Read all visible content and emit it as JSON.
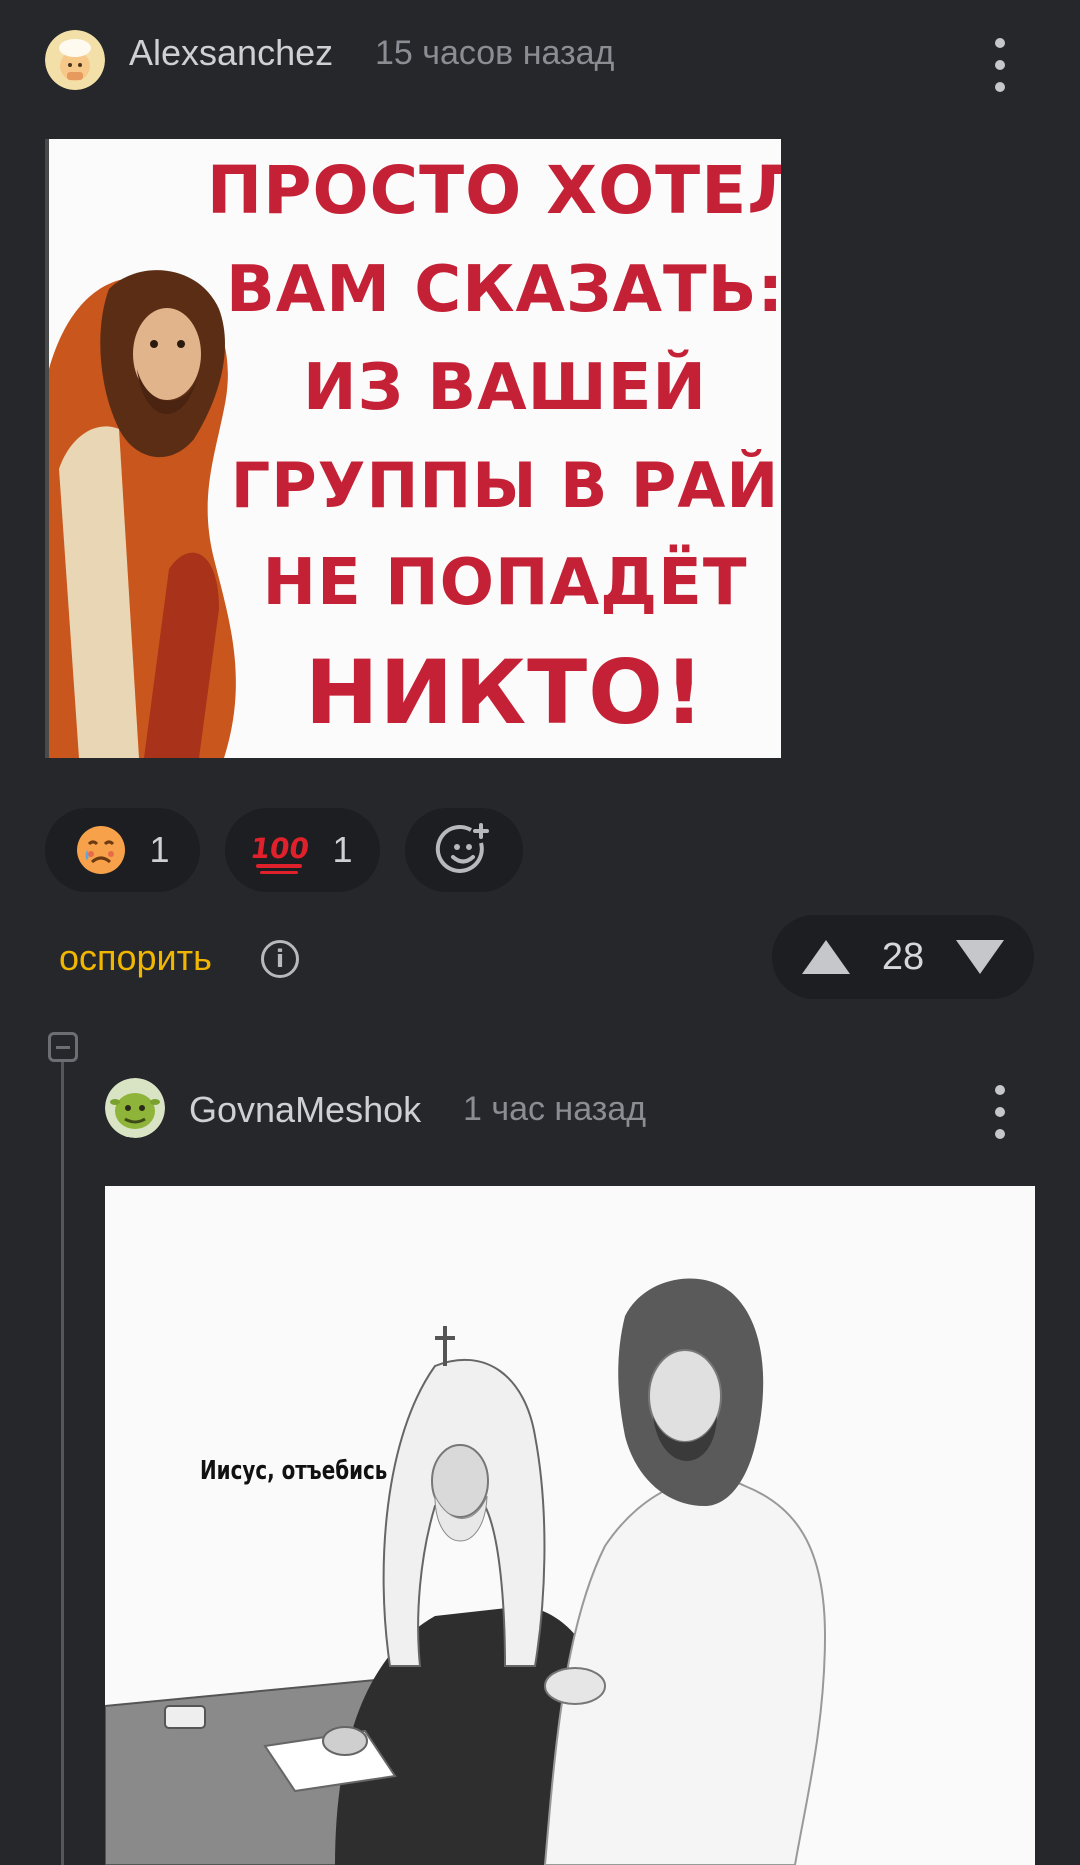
{
  "comments": [
    {
      "author": "Alexsanchez",
      "time": "15 часов назад",
      "avatar_icon": "avatar-baby-icon",
      "image_text_lines": [
        "ПРОСТО ХОТЕЛ",
        "ВАМ СКАЗАТЬ:",
        "ИЗ ВАШЕЙ",
        "ГРУППЫ В РАЙ",
        "НЕ ПОПАДЁТ",
        "НИКТО!"
      ],
      "reactions": [
        {
          "icon": "sad-tear-emoji-icon",
          "count": "1"
        },
        {
          "icon": "hundred-points-emoji-icon",
          "emoji": "💯",
          "count": "1"
        }
      ],
      "add_reaction_icon": "add-emoji-icon",
      "dispute_label": "оспорить",
      "score": "28"
    },
    {
      "author": "GovnaMeshok",
      "time": "1 час назад",
      "avatar_icon": "avatar-shrek-icon",
      "image_caption": "Иисус, отъебись"
    }
  ],
  "colors": {
    "background": "#26272b",
    "pill": "#1d1e21",
    "accent": "#f0b600",
    "meme_red": "#c52136"
  }
}
